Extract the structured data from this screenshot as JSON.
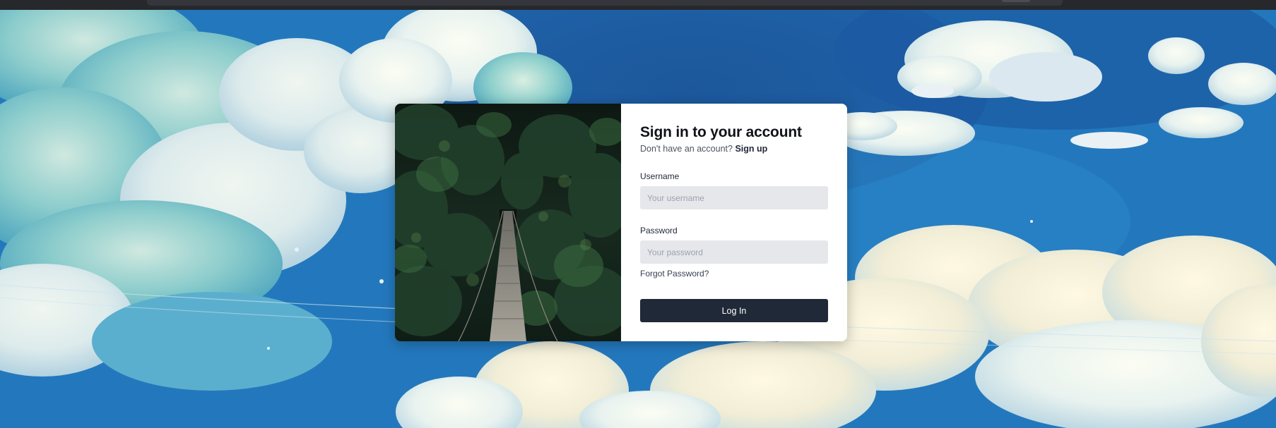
{
  "login": {
    "title": "Sign in to your account",
    "subtitle_prefix": "Don't have an account?",
    "signup_link": "Sign up",
    "username_label": "Username",
    "username_placeholder": "Your username",
    "username_value": "",
    "password_label": "Password",
    "password_placeholder": "Your password",
    "password_value": "",
    "forgot_password": "Forgot Password?",
    "login_button": "Log In"
  },
  "colors": {
    "button_bg": "#1f2937",
    "input_bg": "#e5e7eb",
    "card_bg": "#ffffff"
  },
  "images": {
    "background": "anime-sky-clouds",
    "side_image": "forest-suspension-bridge"
  }
}
